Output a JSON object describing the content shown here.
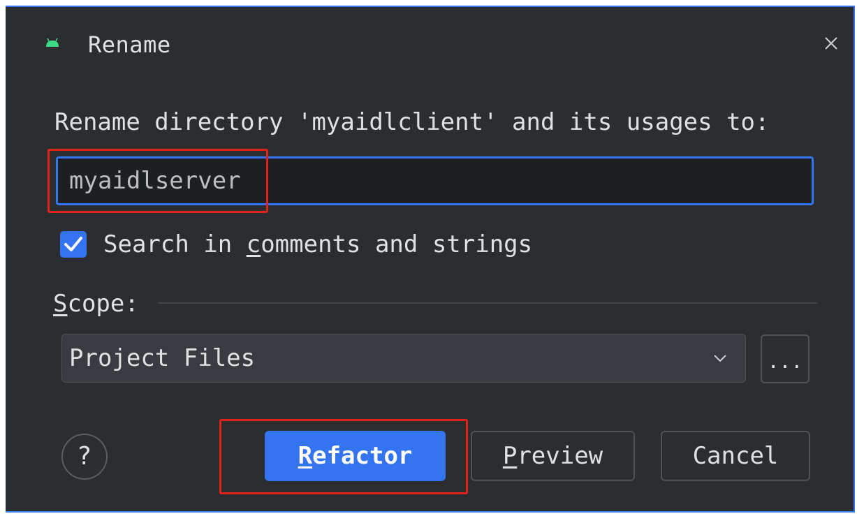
{
  "dialog": {
    "title": "Rename",
    "title_icon": "android-icon",
    "close_icon": "close-icon"
  },
  "prompt": "Rename directory 'myaidlclient' and its usages to:",
  "name_input": {
    "value": "myaidlserver"
  },
  "search_option": {
    "checked": true,
    "label_before": "Search in ",
    "label_mnemonic": "c",
    "label_after": "omments and strings"
  },
  "scope": {
    "label_mnemonic": "S",
    "label_after": "cope:",
    "selected": "Project Files",
    "more_label": "..."
  },
  "buttons": {
    "help": "?",
    "refactor_mnemonic": "R",
    "refactor_rest": "efactor",
    "preview_mnemonic": "P",
    "preview_rest": "review",
    "cancel": "Cancel"
  },
  "colors": {
    "background": "#2b2d30",
    "accent": "#3574f0",
    "highlight_annotation": "#e0241b",
    "android_green": "#3ddc84"
  }
}
